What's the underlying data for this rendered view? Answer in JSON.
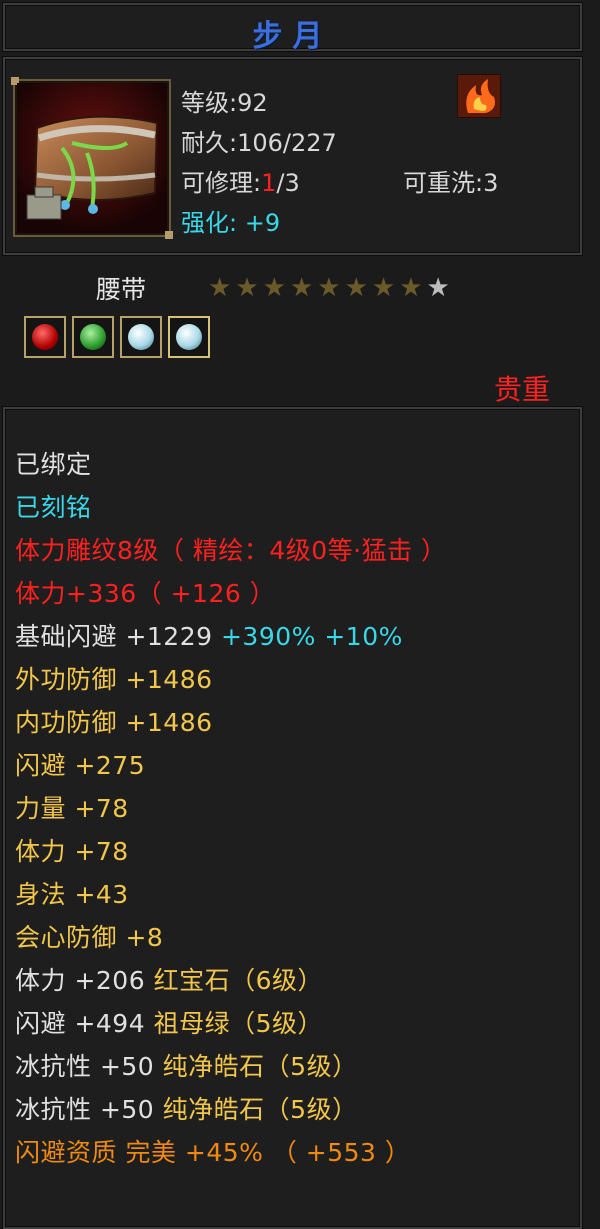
{
  "title": "步月",
  "item": {
    "level_label": "等级",
    "level_value": "92",
    "durability_label": "耐久",
    "durability_value": "106/227",
    "repair_label": "可修理",
    "repair_current": "1",
    "repair_max": "/3",
    "rewash_label": "可重洗",
    "rewash_value": "3",
    "enhance_label": "强化",
    "enhance_value": "+9",
    "slot": "腰带",
    "stars_filled": 8,
    "stars_total": 9,
    "quality": "贵重",
    "gems": [
      "ruby-gem-icon",
      "emerald-gem-icon",
      "diamond-gem-icon",
      "diamond-gem-icon"
    ]
  },
  "details": [
    {
      "text": "已绑定",
      "color": "white"
    },
    {
      "text": "已刻铭",
      "color": "cyan"
    },
    {
      "text": "体力雕纹8级（ 精绘：4级0等·猛击 ）",
      "color": "red"
    },
    {
      "text": "体力+336（ +126 ）",
      "color": "red"
    },
    {
      "text": "基础闪避 +1229",
      "extra": " +390% +10%",
      "color": "white"
    },
    {
      "text": "外功防御 +1486",
      "color": "gold"
    },
    {
      "text": "内功防御 +1486",
      "color": "gold"
    },
    {
      "text": "闪避 +275",
      "color": "gold"
    },
    {
      "text": "力量 +78",
      "color": "gold"
    },
    {
      "text": "体力 +78",
      "color": "gold"
    },
    {
      "text": "身法 +43",
      "color": "gold"
    },
    {
      "text": "会心防御 +8",
      "color": "gold"
    },
    {
      "text": "体力 +206",
      "extra": " 红宝石（6级）",
      "color": "white"
    },
    {
      "text": "闪避 +494",
      "extra": " 祖母绿（5级）",
      "color": "white"
    },
    {
      "text": "冰抗性 +50",
      "extra": " 纯净皓石（5级）",
      "color": "white"
    },
    {
      "text": "冰抗性 +50",
      "extra": " 纯净皓石（5级）",
      "color": "white"
    },
    {
      "text": "闪避资质  完美 +45% （ +553 ）",
      "color": "orange"
    }
  ]
}
